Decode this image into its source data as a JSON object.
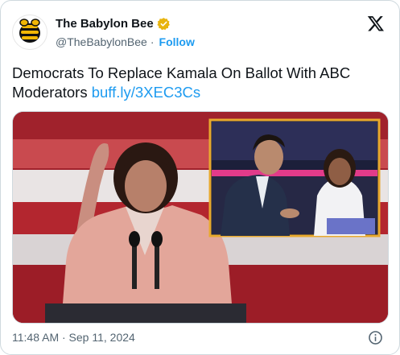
{
  "author": {
    "display_name": "The Babylon Bee",
    "handle": "@TheBabylonBee",
    "separator": "·",
    "follow_label": "Follow",
    "verified_color": "#e8b40e"
  },
  "tweet": {
    "text": "Democrats To Replace Kamala On Ballot With ABC Moderators",
    "link": "buff.ly/3XEC3Cs"
  },
  "media": {
    "description_icon": "photo"
  },
  "footer": {
    "timestamp": "11:48 AM · Sep 11, 2024"
  },
  "colors": {
    "accent": "#1d9bf0",
    "secondary_text": "#536471",
    "inset_border": "#e8a92e"
  }
}
